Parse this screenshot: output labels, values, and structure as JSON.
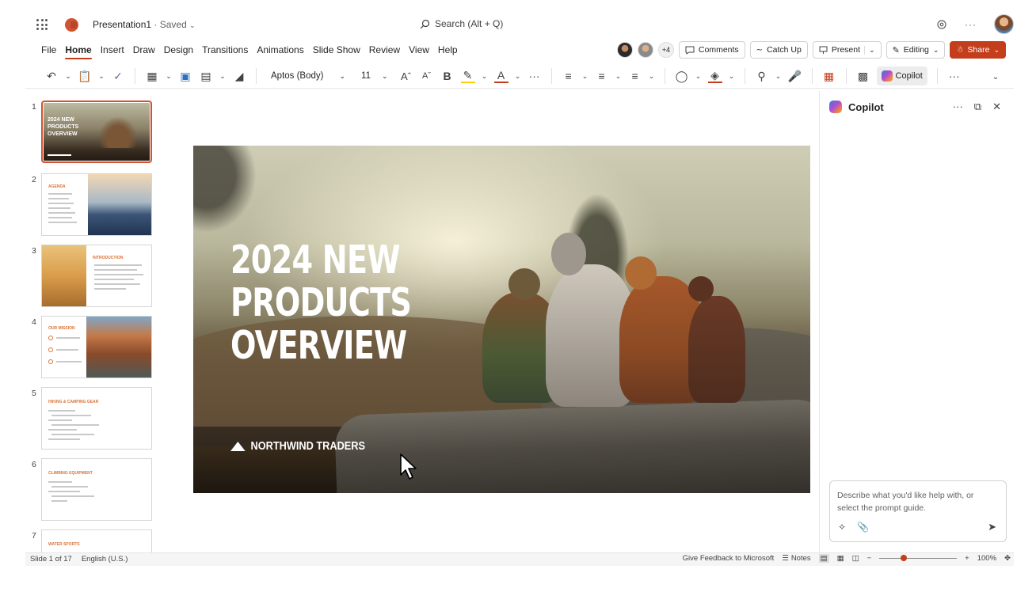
{
  "titlebar": {
    "doc_name": "Presentation1",
    "doc_status": " · Saved",
    "search_placeholder": "Search (Alt + Q)"
  },
  "menu": {
    "items": [
      "File",
      "Home",
      "Insert",
      "Draw",
      "Design",
      "Transitions",
      "Animations",
      "Slide Show",
      "Review",
      "View",
      "Help"
    ],
    "active": "Home",
    "collab_count": "+4",
    "comments": "Comments",
    "catch_up": "Catch Up",
    "present": "Present",
    "editing": "Editing",
    "share": "Share"
  },
  "ribbon": {
    "font_name": "Aptos (Body)",
    "font_size": "11",
    "copilot": "Copilot"
  },
  "slides": {
    "numbers": [
      "1",
      "2",
      "3",
      "4",
      "5",
      "6",
      "7"
    ],
    "selected": 1,
    "thumb1_title": "2024 NEW PRODUCTS OVERVIEW",
    "thumb2_title": "AGENDA",
    "thumb3_title": "INTRODUCTION",
    "thumb4_title": "OUR MISSION",
    "thumb5_title": "HIKING & CAMPING GEAR",
    "thumb6_title": "CLIMBING EQUIPMENT",
    "thumb7_title": "WATER SPORTS"
  },
  "slide": {
    "title_line1": "2024 NEW",
    "title_line2": "PRODUCTS",
    "title_line3": "OVERVIEW",
    "brand": "NORTHWIND TRADERS"
  },
  "copilot": {
    "title": "Copilot",
    "prompt_line1": "Describe what you'd like help with, or",
    "prompt_line2": "select the prompt guide."
  },
  "status": {
    "slide_info": "Slide 1 of 17",
    "language": "English (U.S.)",
    "feedback": "Give Feedback to Microsoft",
    "notes": "Notes",
    "zoom": "100%"
  },
  "colors": {
    "accent": "#c43e1c",
    "powerpoint": "#d35230"
  }
}
